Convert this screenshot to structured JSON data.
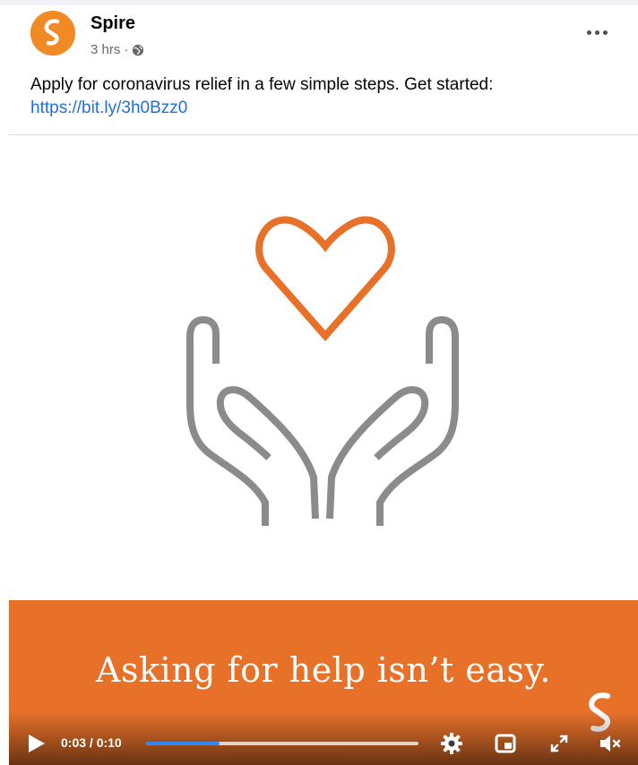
{
  "post": {
    "author": "Spire",
    "time": "3 hrs",
    "separator": "·",
    "audience_icon": "globe-icon",
    "more_icon": "more-dots-icon",
    "text": "Apply for coronavirus relief in a few simple steps. Get started:",
    "link": "https://bit.ly/3h0Bzz0"
  },
  "video": {
    "banner_text": "Asking for help isn’t easy.",
    "current_time": "0:03",
    "duration": "0:10",
    "time_display": "0:03 / 0:10",
    "progress_fraction": 0.27,
    "icons": {
      "play": "play-icon",
      "settings": "gear-icon",
      "pip": "picture-in-picture-icon",
      "fullscreen": "expand-icon",
      "mute": "speaker-muted-icon"
    }
  },
  "colors": {
    "brand_orange": "#e8712a",
    "avatar_orange": "#f08a24",
    "hands_gray": "#8a8b8d",
    "link_blue": "#216fdb",
    "progress_blue": "#2d88ff"
  }
}
